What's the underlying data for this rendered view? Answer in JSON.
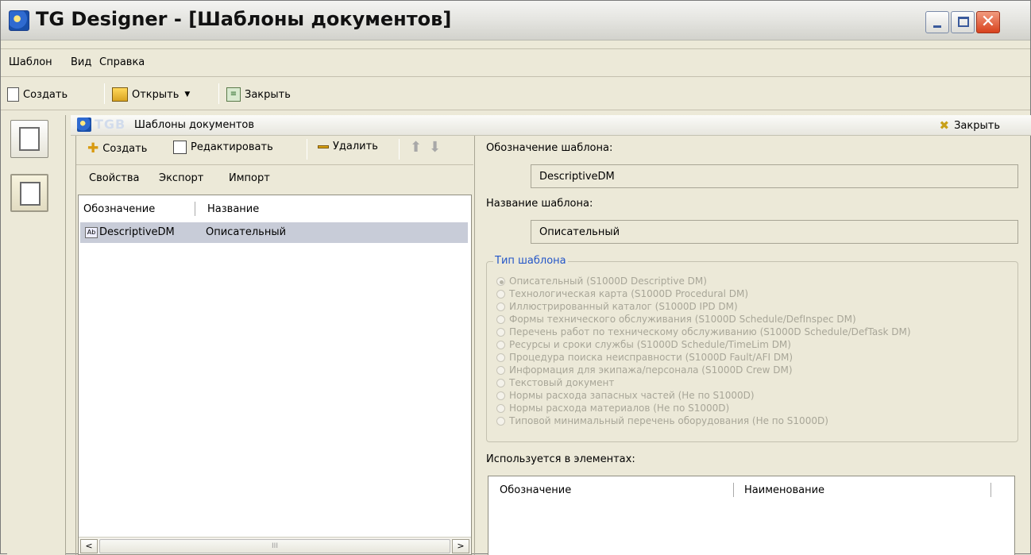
{
  "window": {
    "title": "TG Designer - [Шаблоны документов]",
    "minimize_label": "_",
    "maximize_label": "",
    "close_label": "✕"
  },
  "menu": [
    "Шаблон",
    "Вид",
    "Справка"
  ],
  "toolbar": {
    "create_label": "Создать",
    "open_label": "Открыть",
    "close_label": "Закрыть"
  },
  "panel": {
    "logo_text": "TGB",
    "title": "Шаблоны документов",
    "close_label": "Закрыть"
  },
  "left_toolbar": {
    "create_label": "Создать",
    "edit_label": "Редактировать",
    "delete_label": "Удалить",
    "properties_label": "Свойства",
    "export_label": "Экспорт",
    "import_label": "Импорт"
  },
  "template_list": {
    "columns": [
      "Обозначение",
      "Название"
    ],
    "rows": [
      {
        "designation": "DescriptiveDM",
        "name": "Описательный"
      }
    ]
  },
  "details": {
    "designation_label": "Обозначение шаблона:",
    "designation_value": "DescriptiveDM",
    "name_label": "Название шаблона:",
    "name_value": "Описательный",
    "type_group_label": "Тип шаблона",
    "types": [
      "Описательный (S1000D Descriptive DM)",
      "Технологическая карта (S1000D Procedural DM)",
      "Иллюстрированный каталог (S1000D IPD DM)",
      "Формы технического обслуживания (S1000D Schedule/DefInspec DM)",
      "Перечень работ по техническому обслуживанию (S1000D Schedule/DefTask DM)",
      "Ресурсы и сроки службы (S1000D Schedule/TimeLim DM)",
      "Процедура поиска неисправности (S1000D Fault/AFI DM)",
      "Информация для экипажа/персонала (S1000D Crew DM)",
      "Текстовый документ",
      "Нормы расхода запасных частей (Не по S1000D)",
      "Нормы расхода материалов (Не по S1000D)",
      "Типовой минимальный перечень оборудования (Не по S1000D)"
    ],
    "selected_type_index": 0,
    "used_in_label": "Используется в элементах:",
    "used_in_columns": [
      "Обозначение",
      "Наименование"
    ]
  },
  "hscroll": {
    "left": "<",
    "right": ">",
    "grip": "III"
  }
}
